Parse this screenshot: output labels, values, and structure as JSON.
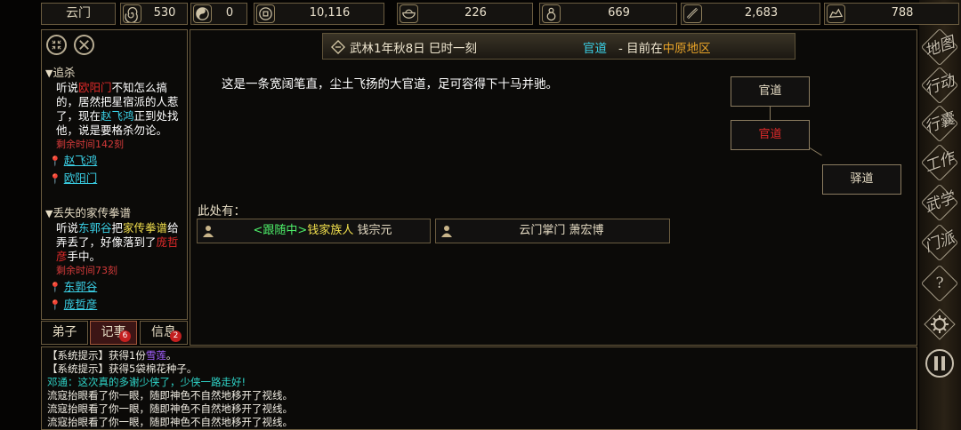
{
  "top": {
    "location": "云门",
    "stats": [
      {
        "icon": "spiral-icon",
        "value": "530"
      },
      {
        "icon": "yinyang-icon",
        "value": "0"
      },
      {
        "icon": "coin-icon",
        "value": "10,116"
      },
      {
        "icon": "bowl-icon",
        "value": "226"
      },
      {
        "icon": "gourd-icon",
        "value": "669"
      },
      {
        "icon": "scroll-icon",
        "value": "2,683"
      },
      {
        "icon": "ore-icon",
        "value": "788"
      }
    ]
  },
  "quests": [
    {
      "title": "追杀",
      "desc_parts": [
        "听说",
        "欧阳门",
        "不知怎么搞的，居然把星宿派的人惹了，现在",
        "赵飞鸿",
        "正到处找他，说是要格杀勿论。"
      ],
      "remain": "剩余时间142刻",
      "locations": [
        "赵飞鸿",
        "欧阳门"
      ]
    },
    {
      "title": "丢失的家传拳谱",
      "desc_parts": [
        "听说",
        "东郭谷",
        "把",
        "家传拳谱",
        "给弄丢了，好像落到了",
        "庞哲彦",
        "手中。"
      ],
      "remain": "剩余时间73刻",
      "locations": [
        "东郭谷",
        "庞哲彦"
      ]
    }
  ],
  "tabs": [
    {
      "label": "弟子",
      "badge": ""
    },
    {
      "label": "记事",
      "badge": "6"
    },
    {
      "label": "信息",
      "badge": "2"
    }
  ],
  "header": {
    "date": "武林1年秋8日 巳时一刻",
    "road": "官道",
    "rest_prefix": " - 目前在",
    "region": "中原地区"
  },
  "description": "这是一条宽阔笔直，尘土飞扬的大官道，足可容得下十马并驰。",
  "map": {
    "north": "官道",
    "current": "官道",
    "southeast": "驿道"
  },
  "here_label": "此处有：",
  "npcs": [
    {
      "follow": "<跟随中>",
      "faction": "钱家族人",
      "name": " 钱宗元"
    },
    {
      "text": "云门掌门 萧宏博"
    }
  ],
  "right_menu": [
    {
      "label": "地图",
      "icon": "map-icon"
    },
    {
      "label": "行动",
      "icon": "action-icon"
    },
    {
      "label": "行囊",
      "icon": "bag-icon"
    },
    {
      "label": "工作",
      "icon": "work-icon"
    },
    {
      "label": "武学",
      "icon": "martial-icon"
    },
    {
      "label": "门派",
      "icon": "sect-icon"
    },
    {
      "label": "?",
      "icon": "help-icon"
    },
    {
      "label": "",
      "icon": "settings-icon"
    },
    {
      "label": "",
      "icon": "pause-icon"
    }
  ],
  "log": [
    {
      "pre": "【系统提示】获得1份",
      "hl": "雪莲",
      "post": "。"
    },
    {
      "pre": "【系统提示】获得5袋棉花种子。",
      "hl": "",
      "post": ""
    },
    {
      "pre": "邓通：这次真的多谢少侠了，少侠一路走好!",
      "hl": "",
      "post": ""
    },
    {
      "pre": "流寇抬眼看了你一眼，随即神色不自然地移开了视线。",
      "hl": "",
      "post": ""
    },
    {
      "pre": "流寇抬眼看了你一眼，随即神色不自然地移开了视线。",
      "hl": "",
      "post": ""
    },
    {
      "pre": "流寇抬眼看了你一眼，随即神色不自然地移开了视线。",
      "hl": "",
      "post": ""
    }
  ]
}
